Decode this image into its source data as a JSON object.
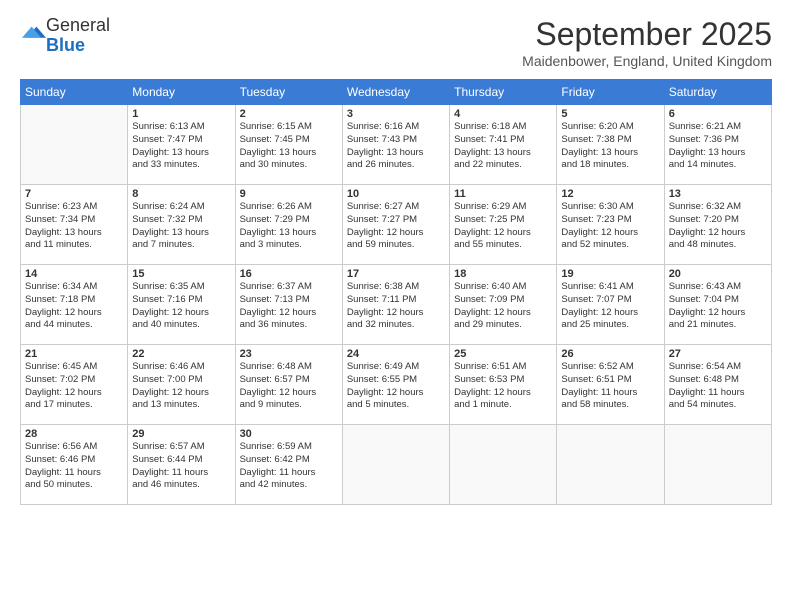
{
  "logo": {
    "general": "General",
    "blue": "Blue"
  },
  "title": "September 2025",
  "subtitle": "Maidenbower, England, United Kingdom",
  "days_of_week": [
    "Sunday",
    "Monday",
    "Tuesday",
    "Wednesday",
    "Thursday",
    "Friday",
    "Saturday"
  ],
  "weeks": [
    [
      {
        "day": "",
        "info": ""
      },
      {
        "day": "1",
        "info": "Sunrise: 6:13 AM\nSunset: 7:47 PM\nDaylight: 13 hours\nand 33 minutes."
      },
      {
        "day": "2",
        "info": "Sunrise: 6:15 AM\nSunset: 7:45 PM\nDaylight: 13 hours\nand 30 minutes."
      },
      {
        "day": "3",
        "info": "Sunrise: 6:16 AM\nSunset: 7:43 PM\nDaylight: 13 hours\nand 26 minutes."
      },
      {
        "day": "4",
        "info": "Sunrise: 6:18 AM\nSunset: 7:41 PM\nDaylight: 13 hours\nand 22 minutes."
      },
      {
        "day": "5",
        "info": "Sunrise: 6:20 AM\nSunset: 7:38 PM\nDaylight: 13 hours\nand 18 minutes."
      },
      {
        "day": "6",
        "info": "Sunrise: 6:21 AM\nSunset: 7:36 PM\nDaylight: 13 hours\nand 14 minutes."
      }
    ],
    [
      {
        "day": "7",
        "info": "Sunrise: 6:23 AM\nSunset: 7:34 PM\nDaylight: 13 hours\nand 11 minutes."
      },
      {
        "day": "8",
        "info": "Sunrise: 6:24 AM\nSunset: 7:32 PM\nDaylight: 13 hours\nand 7 minutes."
      },
      {
        "day": "9",
        "info": "Sunrise: 6:26 AM\nSunset: 7:29 PM\nDaylight: 13 hours\nand 3 minutes."
      },
      {
        "day": "10",
        "info": "Sunrise: 6:27 AM\nSunset: 7:27 PM\nDaylight: 12 hours\nand 59 minutes."
      },
      {
        "day": "11",
        "info": "Sunrise: 6:29 AM\nSunset: 7:25 PM\nDaylight: 12 hours\nand 55 minutes."
      },
      {
        "day": "12",
        "info": "Sunrise: 6:30 AM\nSunset: 7:23 PM\nDaylight: 12 hours\nand 52 minutes."
      },
      {
        "day": "13",
        "info": "Sunrise: 6:32 AM\nSunset: 7:20 PM\nDaylight: 12 hours\nand 48 minutes."
      }
    ],
    [
      {
        "day": "14",
        "info": "Sunrise: 6:34 AM\nSunset: 7:18 PM\nDaylight: 12 hours\nand 44 minutes."
      },
      {
        "day": "15",
        "info": "Sunrise: 6:35 AM\nSunset: 7:16 PM\nDaylight: 12 hours\nand 40 minutes."
      },
      {
        "day": "16",
        "info": "Sunrise: 6:37 AM\nSunset: 7:13 PM\nDaylight: 12 hours\nand 36 minutes."
      },
      {
        "day": "17",
        "info": "Sunrise: 6:38 AM\nSunset: 7:11 PM\nDaylight: 12 hours\nand 32 minutes."
      },
      {
        "day": "18",
        "info": "Sunrise: 6:40 AM\nSunset: 7:09 PM\nDaylight: 12 hours\nand 29 minutes."
      },
      {
        "day": "19",
        "info": "Sunrise: 6:41 AM\nSunset: 7:07 PM\nDaylight: 12 hours\nand 25 minutes."
      },
      {
        "day": "20",
        "info": "Sunrise: 6:43 AM\nSunset: 7:04 PM\nDaylight: 12 hours\nand 21 minutes."
      }
    ],
    [
      {
        "day": "21",
        "info": "Sunrise: 6:45 AM\nSunset: 7:02 PM\nDaylight: 12 hours\nand 17 minutes."
      },
      {
        "day": "22",
        "info": "Sunrise: 6:46 AM\nSunset: 7:00 PM\nDaylight: 12 hours\nand 13 minutes."
      },
      {
        "day": "23",
        "info": "Sunrise: 6:48 AM\nSunset: 6:57 PM\nDaylight: 12 hours\nand 9 minutes."
      },
      {
        "day": "24",
        "info": "Sunrise: 6:49 AM\nSunset: 6:55 PM\nDaylight: 12 hours\nand 5 minutes."
      },
      {
        "day": "25",
        "info": "Sunrise: 6:51 AM\nSunset: 6:53 PM\nDaylight: 12 hours\nand 1 minute."
      },
      {
        "day": "26",
        "info": "Sunrise: 6:52 AM\nSunset: 6:51 PM\nDaylight: 11 hours\nand 58 minutes."
      },
      {
        "day": "27",
        "info": "Sunrise: 6:54 AM\nSunset: 6:48 PM\nDaylight: 11 hours\nand 54 minutes."
      }
    ],
    [
      {
        "day": "28",
        "info": "Sunrise: 6:56 AM\nSunset: 6:46 PM\nDaylight: 11 hours\nand 50 minutes."
      },
      {
        "day": "29",
        "info": "Sunrise: 6:57 AM\nSunset: 6:44 PM\nDaylight: 11 hours\nand 46 minutes."
      },
      {
        "day": "30",
        "info": "Sunrise: 6:59 AM\nSunset: 6:42 PM\nDaylight: 11 hours\nand 42 minutes."
      },
      {
        "day": "",
        "info": ""
      },
      {
        "day": "",
        "info": ""
      },
      {
        "day": "",
        "info": ""
      },
      {
        "day": "",
        "info": ""
      }
    ]
  ]
}
